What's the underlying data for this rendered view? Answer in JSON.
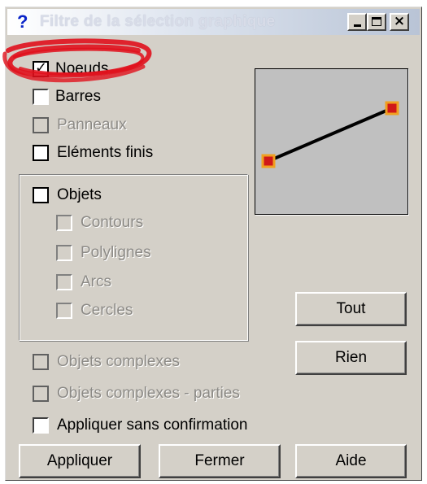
{
  "window": {
    "title_icon": "?",
    "title": "Filtre de la sélection graphique",
    "controls": {
      "minimize": "minimize-icon",
      "maximize": "maximize-icon",
      "close": "×"
    }
  },
  "options": [
    {
      "id": "noeuds",
      "label": "Noeuds",
      "checked": true,
      "enabled": true
    },
    {
      "id": "barres",
      "label": "Barres",
      "checked": false,
      "enabled": true
    },
    {
      "id": "panneaux",
      "label": "Panneaux",
      "checked": false,
      "enabled": false
    },
    {
      "id": "elements-finis",
      "label": "Eléments finis",
      "checked": false,
      "enabled": true
    }
  ],
  "objets_group": {
    "label": "Objets",
    "checked": false,
    "items": [
      {
        "id": "contours",
        "label": "Contours",
        "enabled": false
      },
      {
        "id": "polylignes",
        "label": "Polylignes",
        "enabled": false
      },
      {
        "id": "arcs",
        "label": "Arcs",
        "enabled": false
      },
      {
        "id": "cercles",
        "label": "Cercles",
        "enabled": false
      }
    ]
  },
  "complex_options": [
    {
      "id": "objets-complexes",
      "label": "Objets complexes",
      "enabled": false
    },
    {
      "id": "objets-complexes-parties",
      "label": "Objets complexes - parties",
      "enabled": false
    }
  ],
  "apply_without_confirm": {
    "label": "Appliquer sans confirmation",
    "checked": false
  },
  "side_buttons": {
    "all": "Tout",
    "none": "Rien"
  },
  "bottom_buttons": {
    "apply": "Appliquer",
    "close": "Fermer",
    "help": "Aide"
  },
  "colors": {
    "annotation": "#e0101c",
    "node_fill": "#d01818",
    "node_outline": "#f0a020",
    "preview_bg": "#c0c0c0",
    "dialog_bg": "#d4d0c8"
  }
}
